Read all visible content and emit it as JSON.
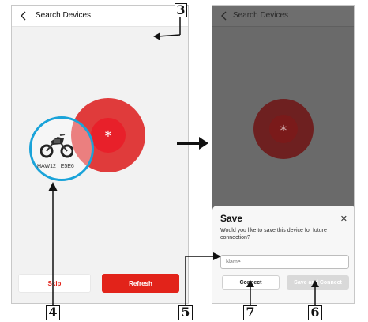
{
  "left_screen": {
    "title": "Search Devices",
    "device_label": "HAW12_ E5E6",
    "skip_label": "Skip",
    "refresh_label": "Refresh"
  },
  "right_screen": {
    "title": "Search Devices",
    "dialog": {
      "title": "Save",
      "close_glyph": "✕",
      "description": "Would you like to save this device for future connection?",
      "name_placeholder": "Name",
      "connect_label": "Connect",
      "save_connect_label": "Save and Connect"
    }
  },
  "callouts": {
    "c3": "3",
    "c4": "4",
    "c5": "5",
    "c6": "6",
    "c7": "7"
  },
  "icons": {
    "back": "chevron-left-icon",
    "bluetooth": "bluetooth-icon",
    "close": "close-icon",
    "motorcycle": "motorcycle-icon"
  },
  "colors": {
    "accent_red": "#e2231a",
    "callout_ring": "#1aa3d9"
  }
}
